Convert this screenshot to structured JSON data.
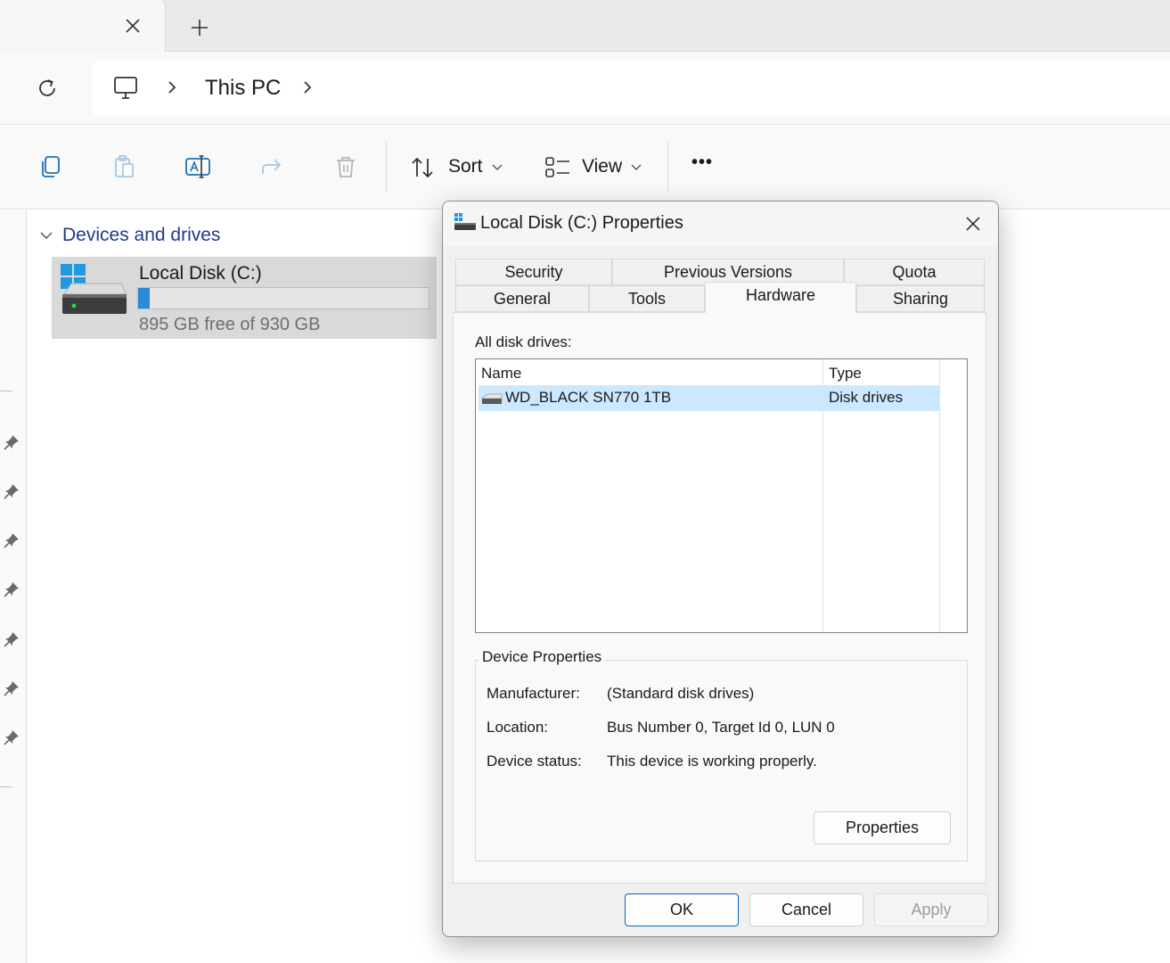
{
  "tabbar": {
    "close_glyph": "✕",
    "new_tab_glyph": "+"
  },
  "address": {
    "crumbs": [
      "This PC"
    ]
  },
  "commands": {
    "sort_label": "Sort",
    "view_label": "View",
    "more_glyph": "•••"
  },
  "content": {
    "section_title": "Devices and drives",
    "drive": {
      "name": "Local Disk (C:)",
      "free_text": "895 GB free of 930 GB",
      "used_fraction": 0.04
    }
  },
  "dialog": {
    "title": "Local Disk (C:) Properties",
    "tabs_top": [
      "Security",
      "Previous Versions",
      "Quota"
    ],
    "tabs_bottom": [
      "General",
      "Tools",
      "Hardware",
      "Sharing"
    ],
    "active_tab": "Hardware",
    "all_disk_drives_label": "All disk drives:",
    "columns": [
      "Name",
      "Type"
    ],
    "rows": [
      {
        "name": "WD_BLACK SN770 1TB",
        "type": "Disk drives"
      }
    ],
    "device_properties": {
      "title": "Device Properties",
      "manufacturer_label": "Manufacturer:",
      "manufacturer_value": "(Standard disk drives)",
      "location_label": "Location:",
      "location_value": "Bus Number 0, Target Id 0, LUN 0",
      "status_label": "Device status:",
      "status_value": "This device is working properly.",
      "properties_button": "Properties"
    },
    "buttons": {
      "ok": "OK",
      "cancel": "Cancel",
      "apply": "Apply"
    }
  },
  "colors": {
    "accent": "#0067c0",
    "selection": "#cce8ff",
    "drive_bar": "#2b8ad9",
    "section_text": "#1f3b8a"
  }
}
